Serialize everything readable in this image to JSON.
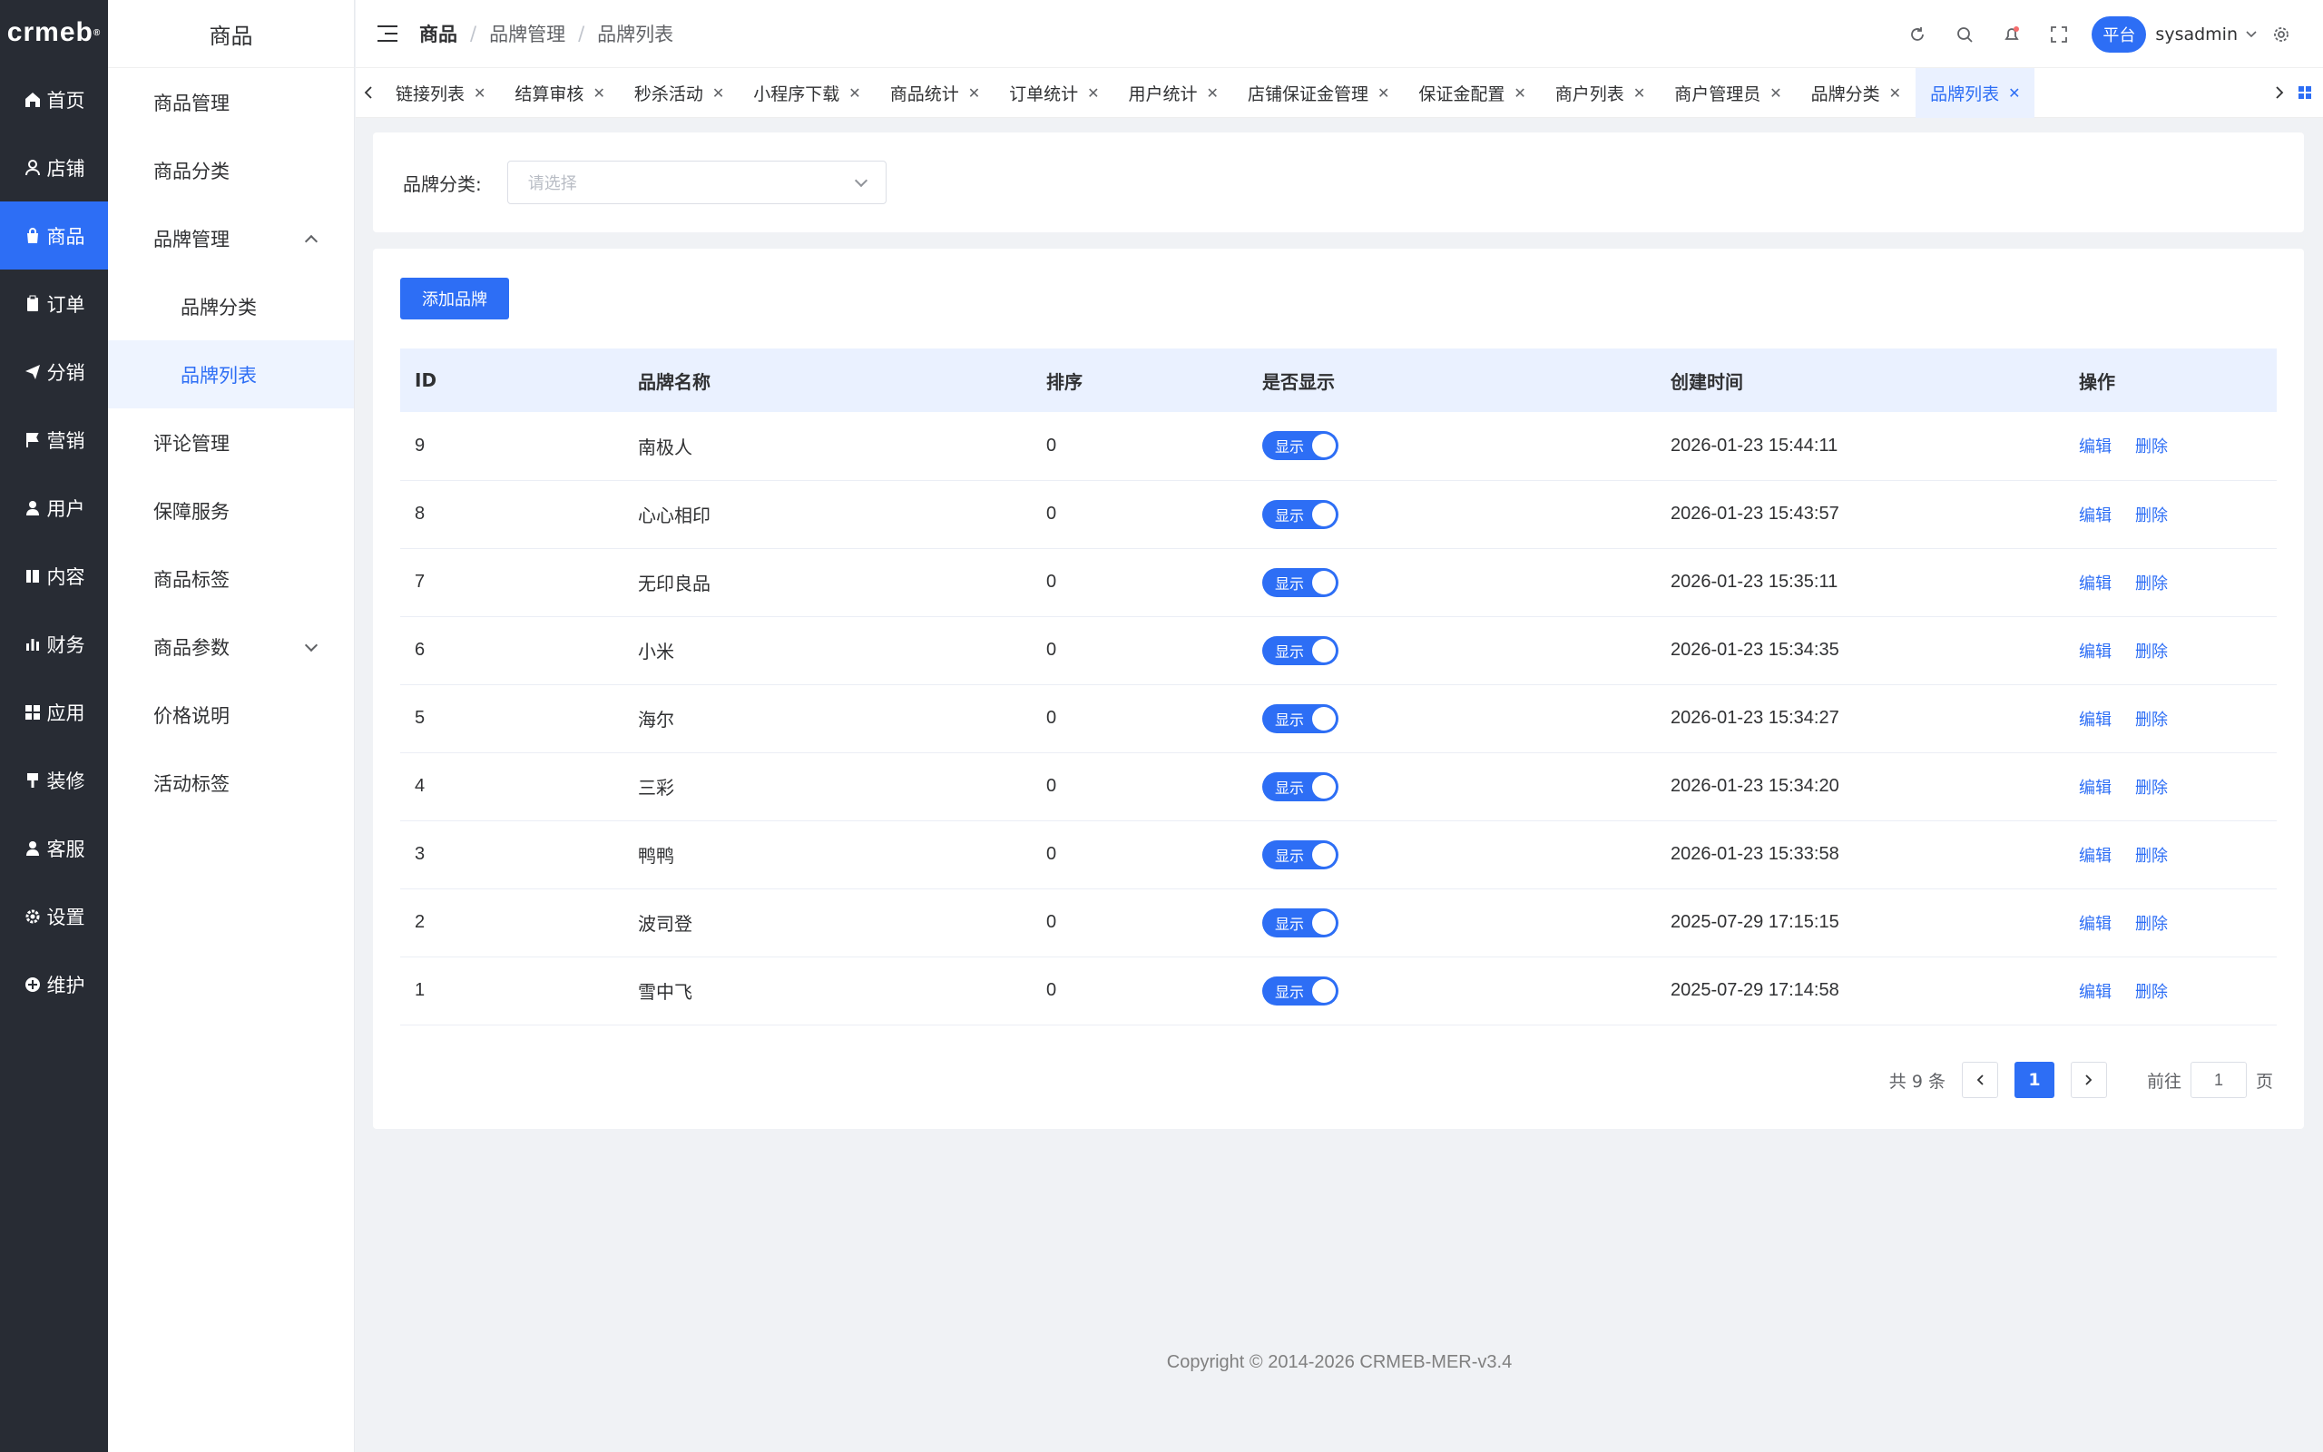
{
  "logo": "crmeb",
  "rail": [
    {
      "label": "首页",
      "icon": "home-icon"
    },
    {
      "label": "店铺",
      "icon": "store-icon"
    },
    {
      "label": "商品",
      "icon": "bag-icon"
    },
    {
      "label": "订单",
      "icon": "clipboard-icon"
    },
    {
      "label": "分销",
      "icon": "send-icon"
    },
    {
      "label": "营销",
      "icon": "flag-icon"
    },
    {
      "label": "用户",
      "icon": "user-icon"
    },
    {
      "label": "内容",
      "icon": "book-icon"
    },
    {
      "label": "财务",
      "icon": "bar-chart-icon"
    },
    {
      "label": "应用",
      "icon": "grid-icon"
    },
    {
      "label": "装修",
      "icon": "brush-icon"
    },
    {
      "label": "客服",
      "icon": "headset-icon"
    },
    {
      "label": "设置",
      "icon": "gear-icon"
    },
    {
      "label": "维护",
      "icon": "wrench-icon"
    }
  ],
  "submenu": {
    "title": "商品",
    "items": [
      {
        "label": "商品管理"
      },
      {
        "label": "商品分类"
      },
      {
        "label": "品牌管理"
      },
      {
        "label": "品牌分类"
      },
      {
        "label": "品牌列表"
      },
      {
        "label": "评论管理"
      },
      {
        "label": "保障服务"
      },
      {
        "label": "商品标签"
      },
      {
        "label": "商品参数"
      },
      {
        "label": "价格说明"
      },
      {
        "label": "活动标签"
      }
    ]
  },
  "breadcrumb": [
    "商品",
    "品牌管理",
    "品牌列表"
  ],
  "header": {
    "platform": "平台",
    "user": "sysadmin"
  },
  "tabs": [
    "链接列表",
    "结算审核",
    "秒杀活动",
    "小程序下载",
    "商品统计",
    "订单统计",
    "用户统计",
    "店铺保证金管理",
    "保证金配置",
    "商户列表",
    "商户管理员",
    "品牌分类",
    "品牌列表"
  ],
  "filter": {
    "label": "品牌分类:",
    "placeholder": "请选择"
  },
  "add_button": "添加品牌",
  "table": {
    "headers": [
      "ID",
      "品牌名称",
      "排序",
      "是否显示",
      "创建时间",
      "操作"
    ],
    "switch_label": "显示",
    "edit_label": "编辑",
    "delete_label": "删除",
    "rows": [
      {
        "id": "9",
        "name": "南极人",
        "sort": "0",
        "created": "2026-01-23 15:44:11"
      },
      {
        "id": "8",
        "name": "心心相印",
        "sort": "0",
        "created": "2026-01-23 15:43:57"
      },
      {
        "id": "7",
        "name": "无印良品",
        "sort": "0",
        "created": "2026-01-23 15:35:11"
      },
      {
        "id": "6",
        "name": "小米",
        "sort": "0",
        "created": "2026-01-23 15:34:35"
      },
      {
        "id": "5",
        "name": "海尔",
        "sort": "0",
        "created": "2026-01-23 15:34:27"
      },
      {
        "id": "4",
        "name": "三彩",
        "sort": "0",
        "created": "2026-01-23 15:34:20"
      },
      {
        "id": "3",
        "name": "鸭鸭",
        "sort": "0",
        "created": "2026-01-23 15:33:58"
      },
      {
        "id": "2",
        "name": "波司登",
        "sort": "0",
        "created": "2025-07-29 17:15:15"
      },
      {
        "id": "1",
        "name": "雪中飞",
        "sort": "0",
        "created": "2025-07-29 17:14:58"
      }
    ]
  },
  "pagination": {
    "total": "共 9 条",
    "current": "1",
    "goto_label": "前往",
    "goto_value": "1",
    "page_suffix": "页"
  },
  "footer": "Copyright © 2014-2026 CRMEB-MER-v3.4",
  "colors": {
    "primary": "#2d6ef5",
    "rail_bg": "#282c34"
  }
}
